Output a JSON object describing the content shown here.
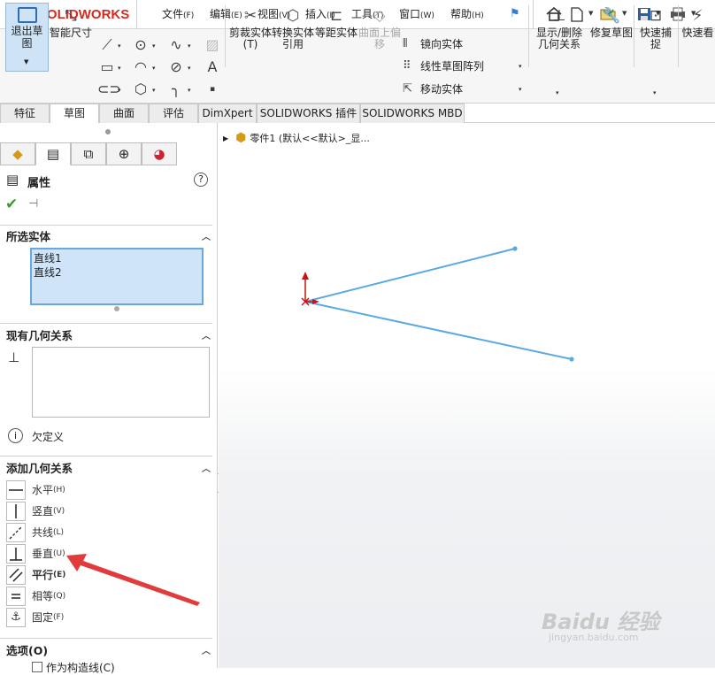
{
  "app": {
    "logo_ds": "3S",
    "logo_text": "SOLIDWORKS"
  },
  "menu": [
    {
      "label": "文件",
      "key": "(F)"
    },
    {
      "label": "编辑",
      "key": "(E)"
    },
    {
      "label": "视图",
      "key": "(V)"
    },
    {
      "label": "插入",
      "key": "(I)"
    },
    {
      "label": "工具",
      "key": "(T)"
    },
    {
      "label": "窗口",
      "key": "(W)"
    },
    {
      "label": "帮助",
      "key": "(H)"
    }
  ],
  "quick_access": [
    "home-icon",
    "new-document-icon",
    "open-folder-icon",
    "save-icon",
    "print-icon"
  ],
  "ribbon": {
    "exit_sketch": "退出草图",
    "smart_dim": "智能尺寸",
    "trim": "剪裁实体(T)",
    "convert": "转换实体引用",
    "offset": "等距实体",
    "surface_offset": "曲面上偏移",
    "mirror": "镜向实体",
    "linear_pattern": "线性草图阵列",
    "move": "移动实体",
    "show_relations": "显示/删除几何关系",
    "repair": "修复草图",
    "quick_snap": "快速捕捉",
    "quick_view": "快速看"
  },
  "tabs": [
    "特征",
    "草图",
    "曲面",
    "评估",
    "DimXpert",
    "SOLIDWORKS 插件",
    "SOLIDWORKS MBD"
  ],
  "active_tab_index": 1,
  "panel": {
    "title": "属性",
    "help": "?",
    "selected_title": "所选实体",
    "selected_items": [
      "直线1",
      "直线2"
    ],
    "existing_title": "现有几何关系",
    "status": "欠定义",
    "add_title": "添加几何关系",
    "relations": [
      {
        "label": "水平",
        "key": "(H)"
      },
      {
        "label": "竖直",
        "key": "(V)"
      },
      {
        "label": "共线",
        "key": "(L)"
      },
      {
        "label": "垂直",
        "key": "(U)"
      },
      {
        "label": "平行",
        "key": "(E)"
      },
      {
        "label": "相等",
        "key": "(Q)"
      },
      {
        "label": "固定",
        "key": "(F)"
      }
    ],
    "options_title": "选项(O)",
    "construction": "作为构造线(C)"
  },
  "tree": {
    "label": "零件1  (默认<<默认>_显..."
  },
  "sketch": {
    "line_color": "#5aa9e0",
    "origin_color": "#cc1111"
  },
  "annotation": {
    "arrow_color": "#e23b3b"
  },
  "watermark": {
    "brand": "Baidu 经验",
    "url": "jingyan.baidu.com"
  }
}
